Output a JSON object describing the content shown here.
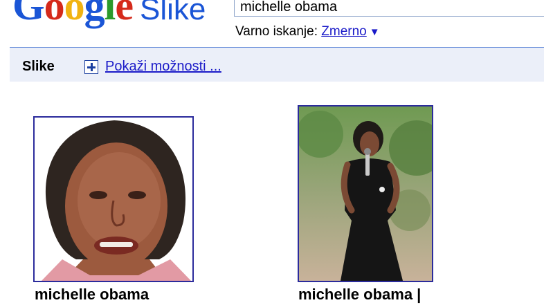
{
  "logo": {
    "brand": "Google",
    "product": "Slike"
  },
  "search": {
    "value": "michelle obama"
  },
  "safe_search": {
    "label": "Varno iskanje:",
    "value": "Zmerno",
    "arrow": "▼"
  },
  "header_bar": {
    "title": "Slike",
    "options_label": "Pokaži možnosti ..."
  },
  "results": [
    {
      "caption": "michelle obama"
    },
    {
      "caption": "michelle obama |"
    }
  ],
  "icons": [
    "plus-icon",
    "dropdown-arrow-icon"
  ],
  "colors": {
    "link": "#1a1ac8",
    "header_bar_bg": "#ebeff9",
    "header_bar_border": "#6b90da",
    "thumb_border": "#2b2b9c"
  }
}
